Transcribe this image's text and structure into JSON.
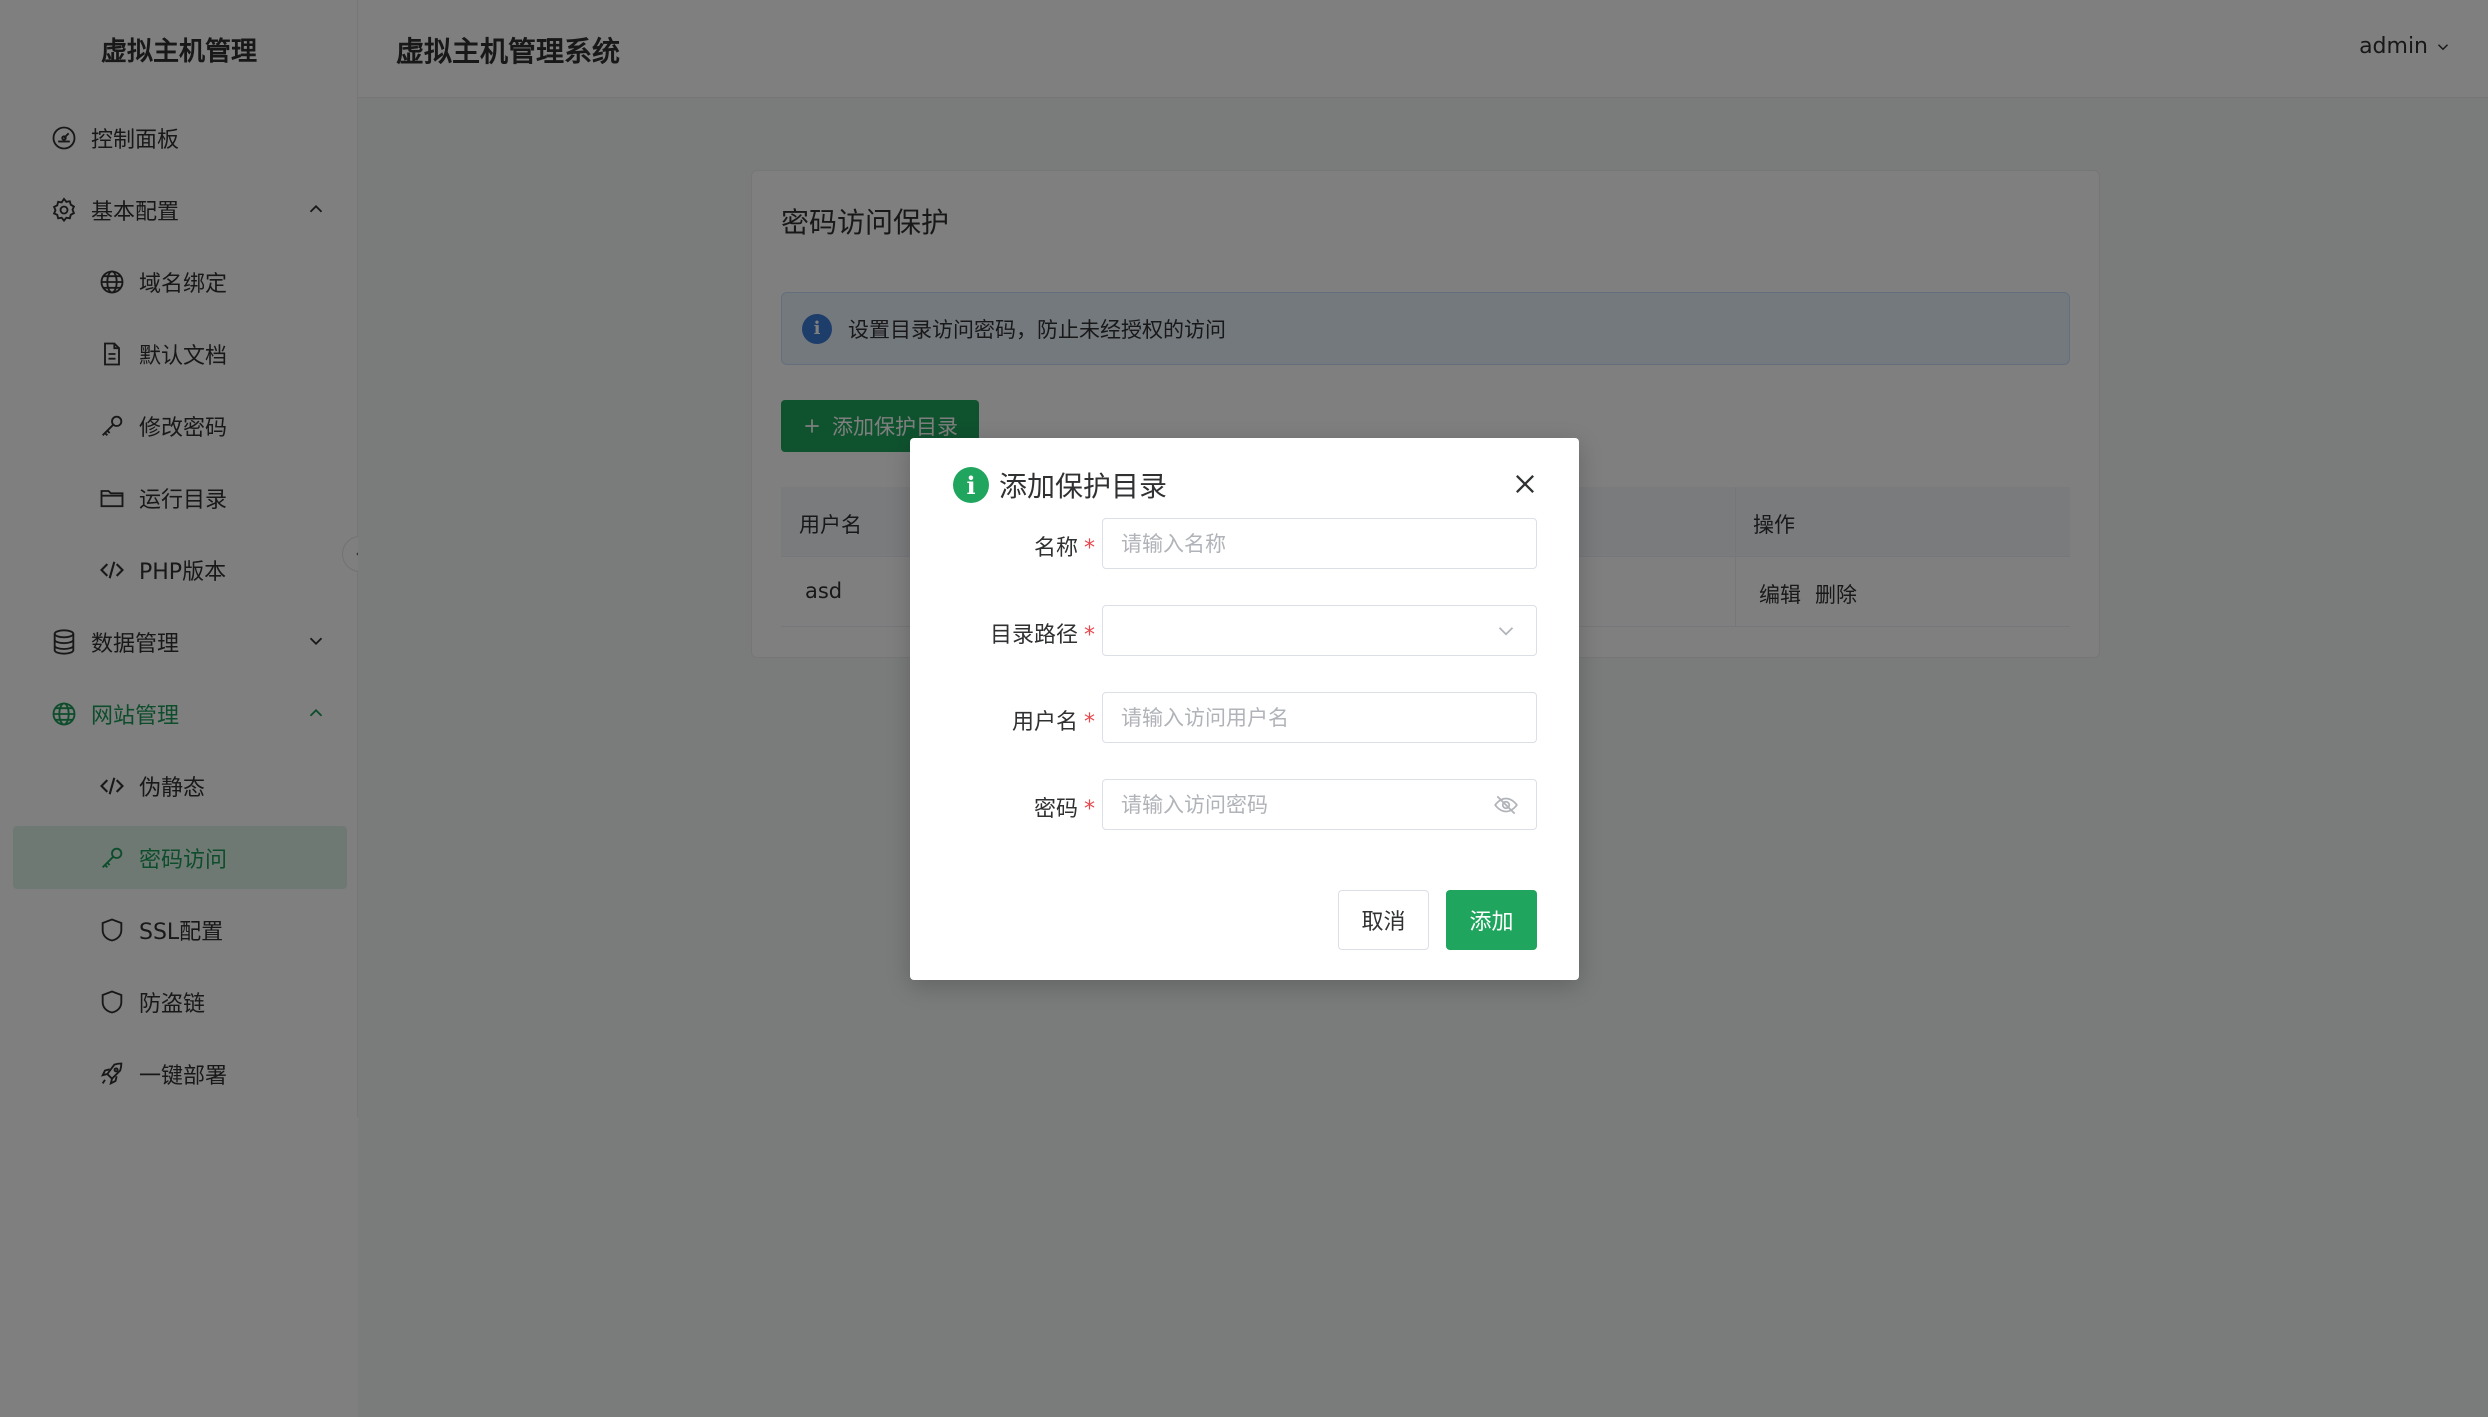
{
  "app": {
    "brand": "虚拟主机管理",
    "header_title": "虚拟主机管理系统",
    "user": "admin"
  },
  "sidebar": {
    "items": [
      {
        "label": "控制面板",
        "icon": "dashboard-icon"
      },
      {
        "label": "基本配置",
        "icon": "gear-icon",
        "expanded": true
      },
      {
        "label": "域名绑定",
        "icon": "globe-icon"
      },
      {
        "label": "默认文档",
        "icon": "document-icon"
      },
      {
        "label": "修改密码",
        "icon": "key-icon"
      },
      {
        "label": "运行目录",
        "icon": "folder-icon"
      },
      {
        "label": "PHP版本",
        "icon": "code-icon"
      },
      {
        "label": "数据管理",
        "icon": "database-icon",
        "expanded": false
      },
      {
        "label": "网站管理",
        "icon": "globe-icon",
        "expanded": true
      },
      {
        "label": "伪静态",
        "icon": "code-icon"
      },
      {
        "label": "密码访问",
        "icon": "key-icon",
        "active": true
      },
      {
        "label": "SSL配置",
        "icon": "shield-icon"
      },
      {
        "label": "防盗链",
        "icon": "shield-icon"
      },
      {
        "label": "一键部署",
        "icon": "rocket-icon"
      }
    ]
  },
  "page": {
    "title": "密码访问保护",
    "alert": "设置目录访问密码，防止未经授权的访问",
    "add_button": "添加保护目录",
    "table": {
      "headers": [
        "用户名",
        "操作"
      ],
      "rows": [
        {
          "username": "asd",
          "actions": [
            "编辑",
            "删除"
          ]
        }
      ]
    }
  },
  "dialog": {
    "title": "添加保护目录",
    "fields": {
      "name": {
        "label": "名称",
        "placeholder": "请输入名称",
        "value": ""
      },
      "path": {
        "label": "目录路径",
        "placeholder": "",
        "value": ""
      },
      "username": {
        "label": "用户名",
        "placeholder": "请输入访问用户名",
        "value": ""
      },
      "password": {
        "label": "密码",
        "placeholder": "请输入访问密码",
        "value": ""
      }
    },
    "required_mark": "*",
    "cancel": "取消",
    "confirm": "添加"
  },
  "colors": {
    "accent": "#1fa55d",
    "info": "#3a7bd5",
    "required": "#e5484d"
  }
}
